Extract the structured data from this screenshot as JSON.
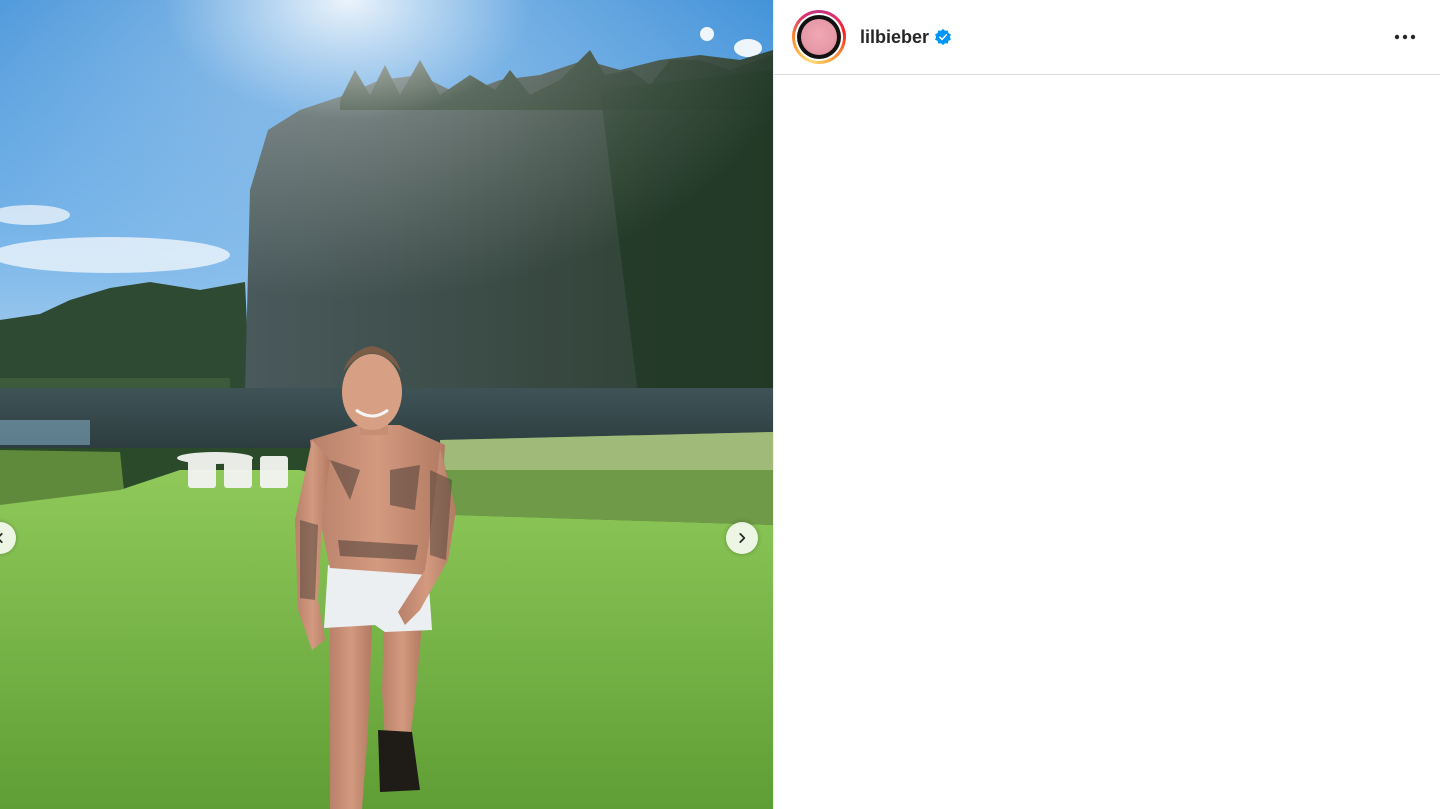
{
  "post": {
    "username": "lilbieber",
    "verified": true
  },
  "icons": {
    "verified": "verified-badge-icon",
    "more": "more-options-icon",
    "next": "chevron-right-icon",
    "prev": "chevron-left-icon"
  },
  "colors": {
    "verified_blue": "#0095f6",
    "text_primary": "#262626",
    "divider": "#dbdbdb"
  }
}
